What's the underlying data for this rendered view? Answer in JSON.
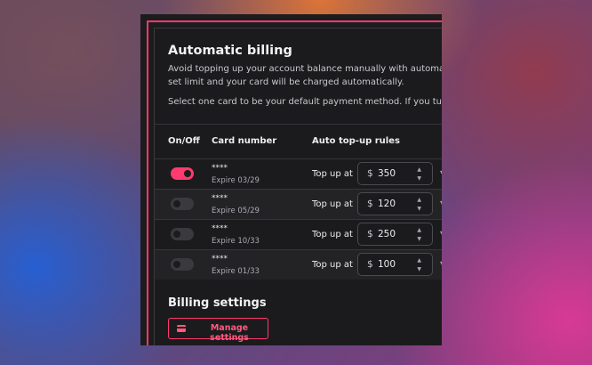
{
  "billing": {
    "title": "Automatic billing",
    "description_line1": "Avoid topping up your account balance manually with automatic billi",
    "description_line2": "set limit and your card will be charged automatically.",
    "description_line3": "Select one card to be your default payment method. If you turn on a r"
  },
  "table": {
    "headers": [
      "On/Off",
      "Card number",
      "Auto top-up rules"
    ],
    "rows": [
      {
        "enabled": true,
        "card": "****",
        "expire": "Expire 03/29",
        "rule_label": "Top up at",
        "currency": "$",
        "amount": "350"
      },
      {
        "enabled": false,
        "card": "****",
        "expire": "Expire 05/29",
        "rule_label": "Top up at",
        "currency": "$",
        "amount": "120"
      },
      {
        "enabled": false,
        "card": "****",
        "expire": "Expire 10/33",
        "rule_label": "Top up at",
        "currency": "$",
        "amount": "250"
      },
      {
        "enabled": false,
        "card": "****",
        "expire": "Expire 01/33",
        "rule_label": "Top up at",
        "currency": "$",
        "amount": "100"
      }
    ]
  },
  "settings": {
    "title": "Billing settings",
    "manage_label": "Manage settings"
  },
  "colors": {
    "accent": "#ff3a6e",
    "panel": "#1b1b1d"
  }
}
